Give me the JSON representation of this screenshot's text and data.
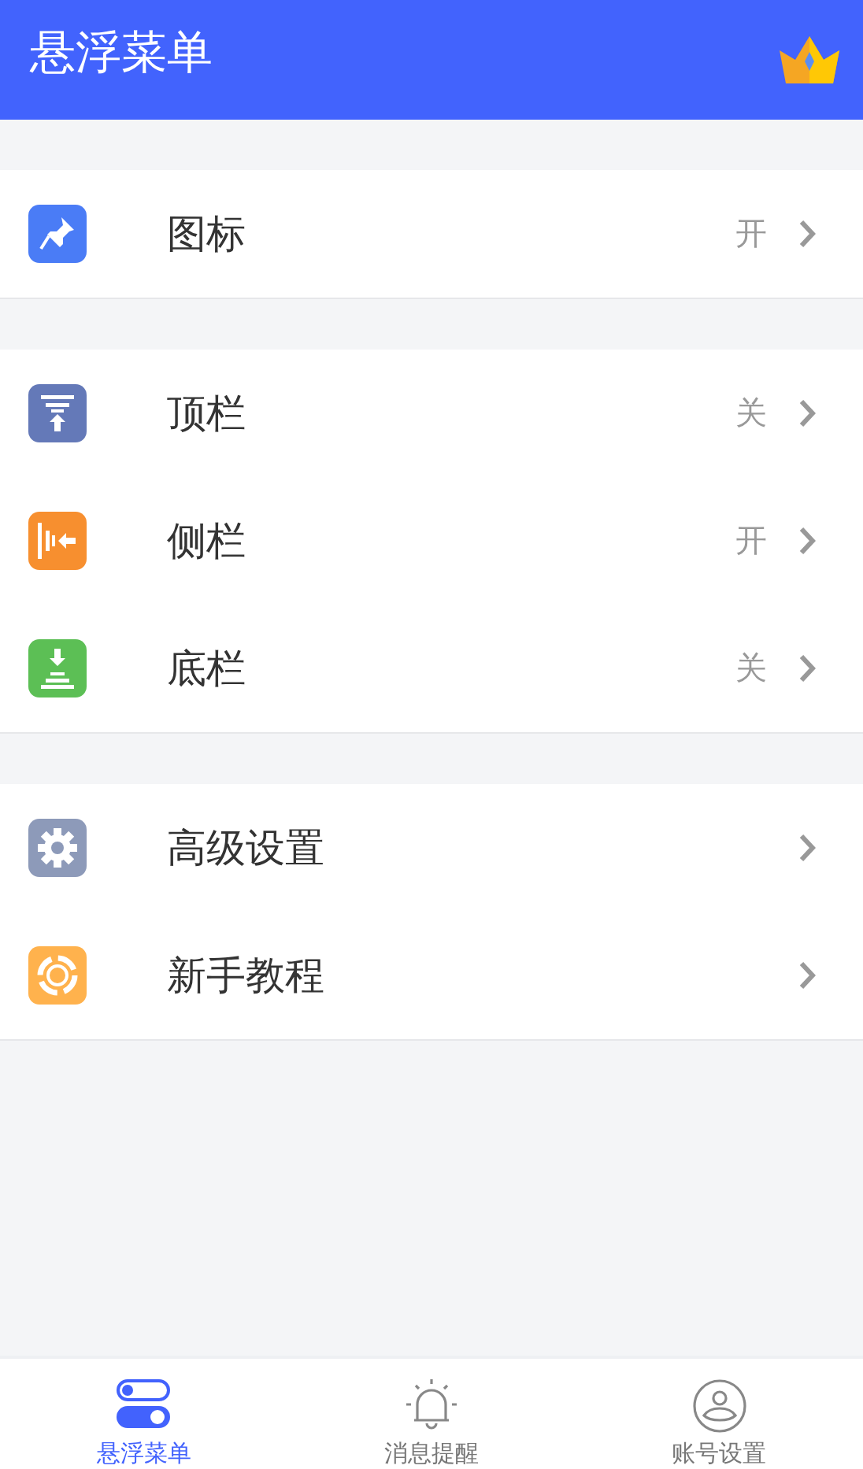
{
  "header": {
    "title": "悬浮菜单"
  },
  "sections": [
    {
      "items": [
        {
          "kind": "pin",
          "color": "#4a7cf6",
          "label": "图标",
          "value": "开"
        }
      ]
    },
    {
      "items": [
        {
          "kind": "top",
          "color": "#6479b8",
          "label": "顶栏",
          "value": "关"
        },
        {
          "kind": "side",
          "color": "#f78f2f",
          "label": "侧栏",
          "value": "开"
        },
        {
          "kind": "bottom",
          "color": "#5cbf55",
          "label": "底栏",
          "value": "关"
        }
      ]
    },
    {
      "items": [
        {
          "kind": "gear",
          "color": "#8d9ab9",
          "label": "高级设置"
        },
        {
          "kind": "lifebuoy",
          "color": "#ffb24d",
          "label": "新手教程"
        }
      ]
    }
  ],
  "tabs": [
    {
      "kind": "toggles",
      "label": "悬浮菜单",
      "selected": true
    },
    {
      "kind": "bell",
      "label": "消息提醒",
      "selected": false
    },
    {
      "kind": "person",
      "label": "账号设置",
      "selected": false
    }
  ]
}
